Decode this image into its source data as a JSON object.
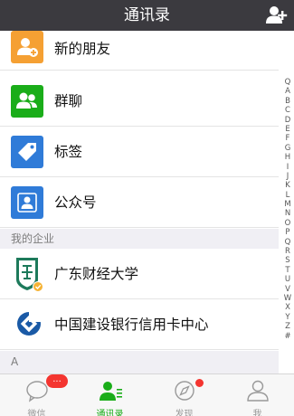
{
  "header": {
    "title": "通讯录"
  },
  "contacts_functions": [
    {
      "label": "新的朋友",
      "icon": "add-person-icon",
      "color": "#f5a033"
    },
    {
      "label": "群聊",
      "icon": "group-icon",
      "color": "#1aad19"
    },
    {
      "label": "标签",
      "icon": "tag-icon",
      "color": "#2f7bd8"
    },
    {
      "label": "公众号",
      "icon": "official-account-icon",
      "color": "#2f7bd8"
    }
  ],
  "enterprise_section": {
    "title": "我的企业",
    "items": [
      {
        "label": "广东财经大学",
        "icon": "university-logo-icon"
      },
      {
        "label": "中国建设银行信用卡中心",
        "icon": "ccb-logo-icon"
      }
    ]
  },
  "letter_section": {
    "title": "A"
  },
  "index_letters": [
    "Q",
    "A",
    "B",
    "C",
    "D",
    "E",
    "F",
    "G",
    "H",
    "I",
    "J",
    "K",
    "L",
    "M",
    "N",
    "O",
    "P",
    "Q",
    "R",
    "S",
    "T",
    "U",
    "V",
    "W",
    "X",
    "Y",
    "Z",
    "#"
  ],
  "tabbar": {
    "tabs": [
      {
        "label": "微信",
        "badge": "...",
        "active": false
      },
      {
        "label": "通讯录",
        "active": true
      },
      {
        "label": "发现",
        "active": false
      },
      {
        "label": "我",
        "active": false
      }
    ]
  },
  "colors": {
    "accent": "#1aad19",
    "header_bg": "#3b3a3f",
    "badge": "#f43530"
  }
}
